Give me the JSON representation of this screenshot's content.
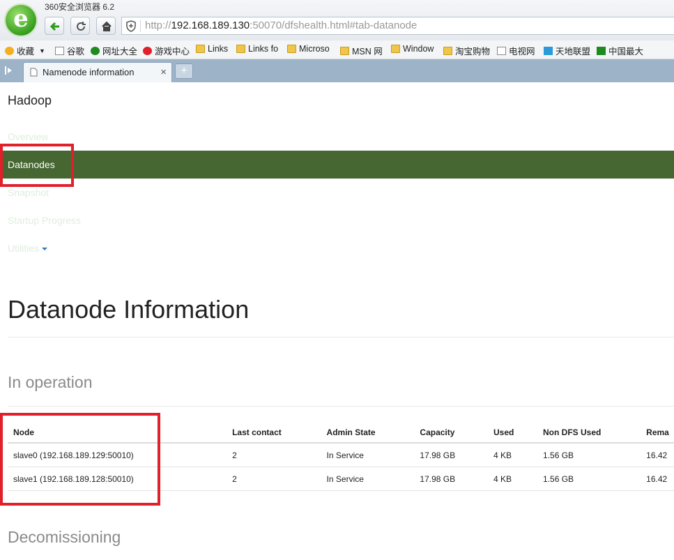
{
  "browser": {
    "title": "360安全浏览器 6.2",
    "url_prefix": "http://",
    "url_host": "192.168.189.130",
    "url_rest": ":50070/dfshealth.html#tab-datanode"
  },
  "favorites": [
    "收藏",
    "谷歌",
    "网址大全",
    "游戏中心",
    "Links",
    "Links fo",
    "Microso",
    "MSN 网",
    "Window",
    "淘宝购物",
    "电视网",
    "天地联盟",
    "中国最大"
  ],
  "tab": {
    "label": "Namenode information",
    "close": "×",
    "new": "+"
  },
  "app": {
    "brand": "Hadoop"
  },
  "nav": [
    "Overview",
    "Datanodes",
    "Snapshot",
    "Startup Progress",
    "Utilities"
  ],
  "page": {
    "title": "Datanode Information",
    "section_operation": "In operation",
    "section_decom": "Decomissioning"
  },
  "table": {
    "headers": [
      "Node",
      "Last contact",
      "Admin State",
      "Capacity",
      "Used",
      "Non DFS Used",
      "Rema"
    ],
    "rows": [
      [
        "slave0 (192.168.189.129:50010)",
        "2",
        "In Service",
        "17.98 GB",
        "4 KB",
        "1.56 GB",
        "16.42"
      ],
      [
        "slave1 (192.168.189.128:50010)",
        "2",
        "In Service",
        "17.98 GB",
        "4 KB",
        "1.56 GB",
        "16.42"
      ]
    ]
  },
  "colors": {
    "nav_active_bg": "#466632",
    "highlight_border": "#e0202a",
    "tabbar_bg": "#9db3c8"
  }
}
